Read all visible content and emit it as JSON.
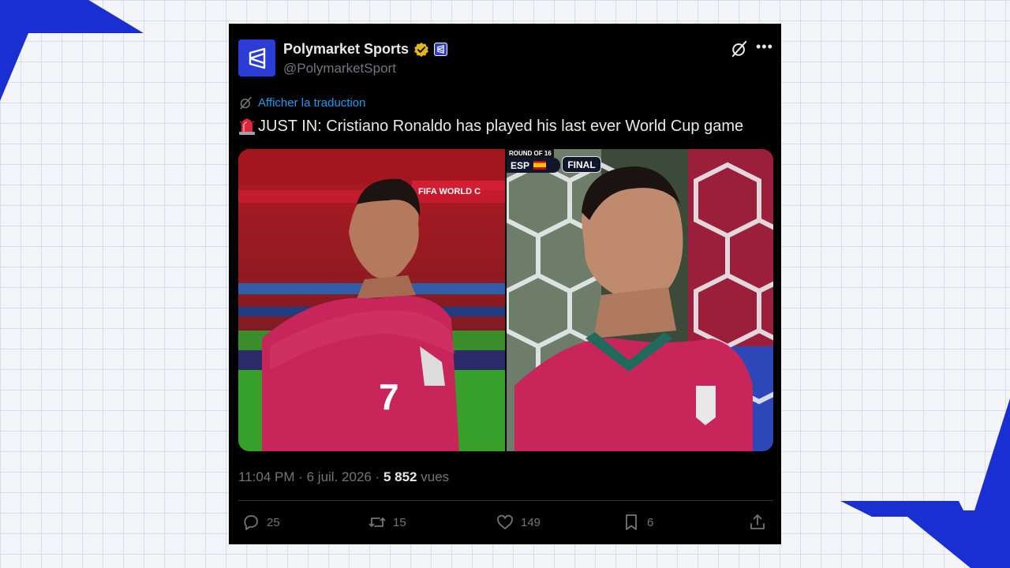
{
  "colors": {
    "page_background": "#f4f5f8",
    "deco_blue": "#1a2fd1",
    "tweet_background": "#000000",
    "text_primary": "#e7e9ea",
    "text_secondary": "#71767b",
    "link_blue": "#1d9bf0",
    "verified_gold": "#e2b719",
    "brand_blue": "#2b3dd6"
  },
  "tweet": {
    "author": {
      "display_name": "Polymarket Sports",
      "handle": "@PolymarketSport",
      "avatar_icon": "polymarket-logo-icon",
      "verified_icon": "gold-verified-badge-icon",
      "affiliate_icon": "polymarket-affiliate-badge-icon"
    },
    "header_actions": {
      "grok_icon": "grok-icon",
      "more_icon": "more-horizontal-icon",
      "more_label": "•••"
    },
    "translate": {
      "icon": "translate-icon",
      "label": "Afficher la traduction"
    },
    "text": {
      "emoji_icon": "rotating-light-icon",
      "body": "JUST IN: Cristiano Ronaldo has played his last ever World Cup game"
    },
    "media": {
      "left_panel": {
        "banner_text": "FIFA WORLD C"
      },
      "right_panel": {
        "round_label": "ROUND OF 16",
        "team_code": "ESP",
        "status": "FINAL"
      }
    },
    "meta": {
      "time": "11:04 PM",
      "separator": " · ",
      "date": "6 juil. 2026",
      "views_count": "5 852",
      "views_label": "vues"
    },
    "actions": {
      "replies": {
        "icon": "reply-icon",
        "count": "25"
      },
      "reposts": {
        "icon": "repost-icon",
        "count": "15"
      },
      "likes": {
        "icon": "like-icon",
        "count": "149"
      },
      "bookmarks": {
        "icon": "bookmark-icon",
        "count": "6"
      },
      "share": {
        "icon": "share-icon"
      }
    }
  }
}
